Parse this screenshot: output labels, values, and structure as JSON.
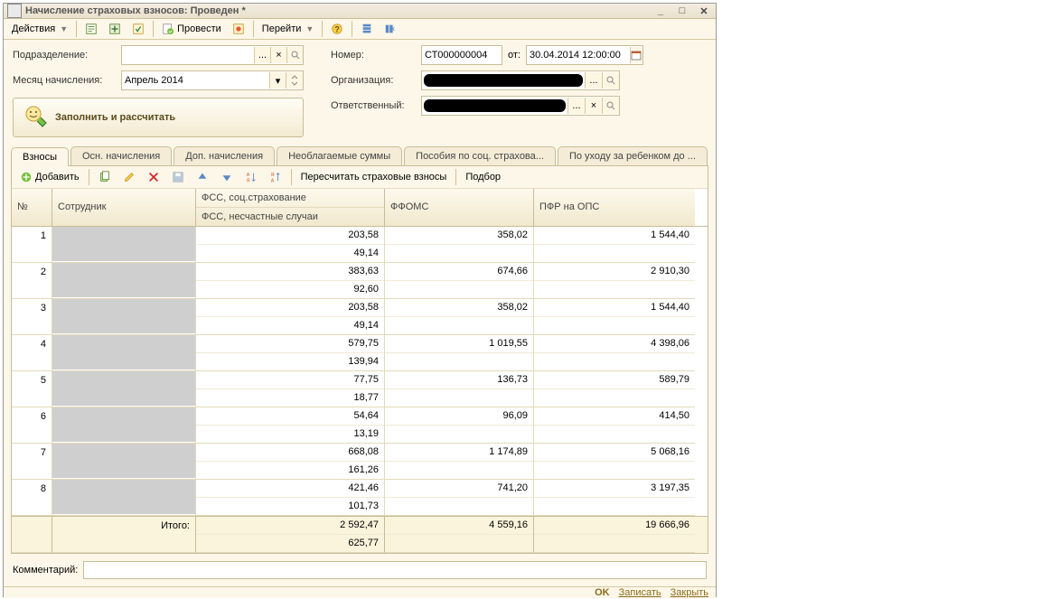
{
  "title": "Начисление страховых взносов: Проведен *",
  "toolbar": {
    "actions": "Действия",
    "post": "Провести",
    "goto": "Перейти"
  },
  "form": {
    "subdivision_lbl": "Подразделение:",
    "month_lbl": "Месяц начисления:",
    "month_val": "Апрель 2014",
    "number_lbl": "Номер:",
    "number_val": "СТ000000004",
    "from_lbl": "от:",
    "date_val": "30.04.2014 12:00:00",
    "org_lbl": "Организация:",
    "resp_lbl": "Ответственный:",
    "fill_calc": "Заполнить и рассчитать"
  },
  "tabs": [
    "Взносы",
    "Осн. начисления",
    "Доп. начисления",
    "Необлагаемые суммы",
    "Пособия по соц. страхова...",
    "По уходу за ребенком до ..."
  ],
  "ptoolbar": {
    "add": "Добавить",
    "recalc": "Пересчитать страховые взносы",
    "select": "Подбор"
  },
  "headers": {
    "num": "№",
    "emp": "Сотрудник",
    "fss1": "ФСС, соц.страхование",
    "fss2": "ФСС, несчастные случаи",
    "ffoms": "ФФОМС",
    "pfr": "ПФР на ОПС"
  },
  "rows": [
    {
      "n": "1",
      "fss1": "203,58",
      "fss2": "49,14",
      "ffoms": "358,02",
      "pfr": "1 544,40"
    },
    {
      "n": "2",
      "fss1": "383,63",
      "fss2": "92,60",
      "ffoms": "674,66",
      "pfr": "2 910,30"
    },
    {
      "n": "3",
      "fss1": "203,58",
      "fss2": "49,14",
      "ffoms": "358,02",
      "pfr": "1 544,40"
    },
    {
      "n": "4",
      "fss1": "579,75",
      "fss2": "139,94",
      "ffoms": "1 019,55",
      "pfr": "4 398,06"
    },
    {
      "n": "5",
      "fss1": "77,75",
      "fss2": "18,77",
      "ffoms": "136,73",
      "pfr": "589,79"
    },
    {
      "n": "6",
      "fss1": "54,64",
      "fss2": "13,19",
      "ffoms": "96,09",
      "pfr": "414,50"
    },
    {
      "n": "7",
      "fss1": "668,08",
      "fss2": "161,26",
      "ffoms": "1 174,89",
      "pfr": "5 068,16"
    },
    {
      "n": "8",
      "fss1": "421,46",
      "fss2": "101,73",
      "ffoms": "741,20",
      "pfr": "3 197,35"
    }
  ],
  "total": {
    "lbl": "Итого:",
    "fss1": "2 592,47",
    "fss2": "625,77",
    "ffoms": "4 559,16",
    "pfr": "19 666,96"
  },
  "comment_lbl": "Комментарий:",
  "footer": {
    "ok": "OK",
    "save": "Записать",
    "close": "Закрыть"
  }
}
